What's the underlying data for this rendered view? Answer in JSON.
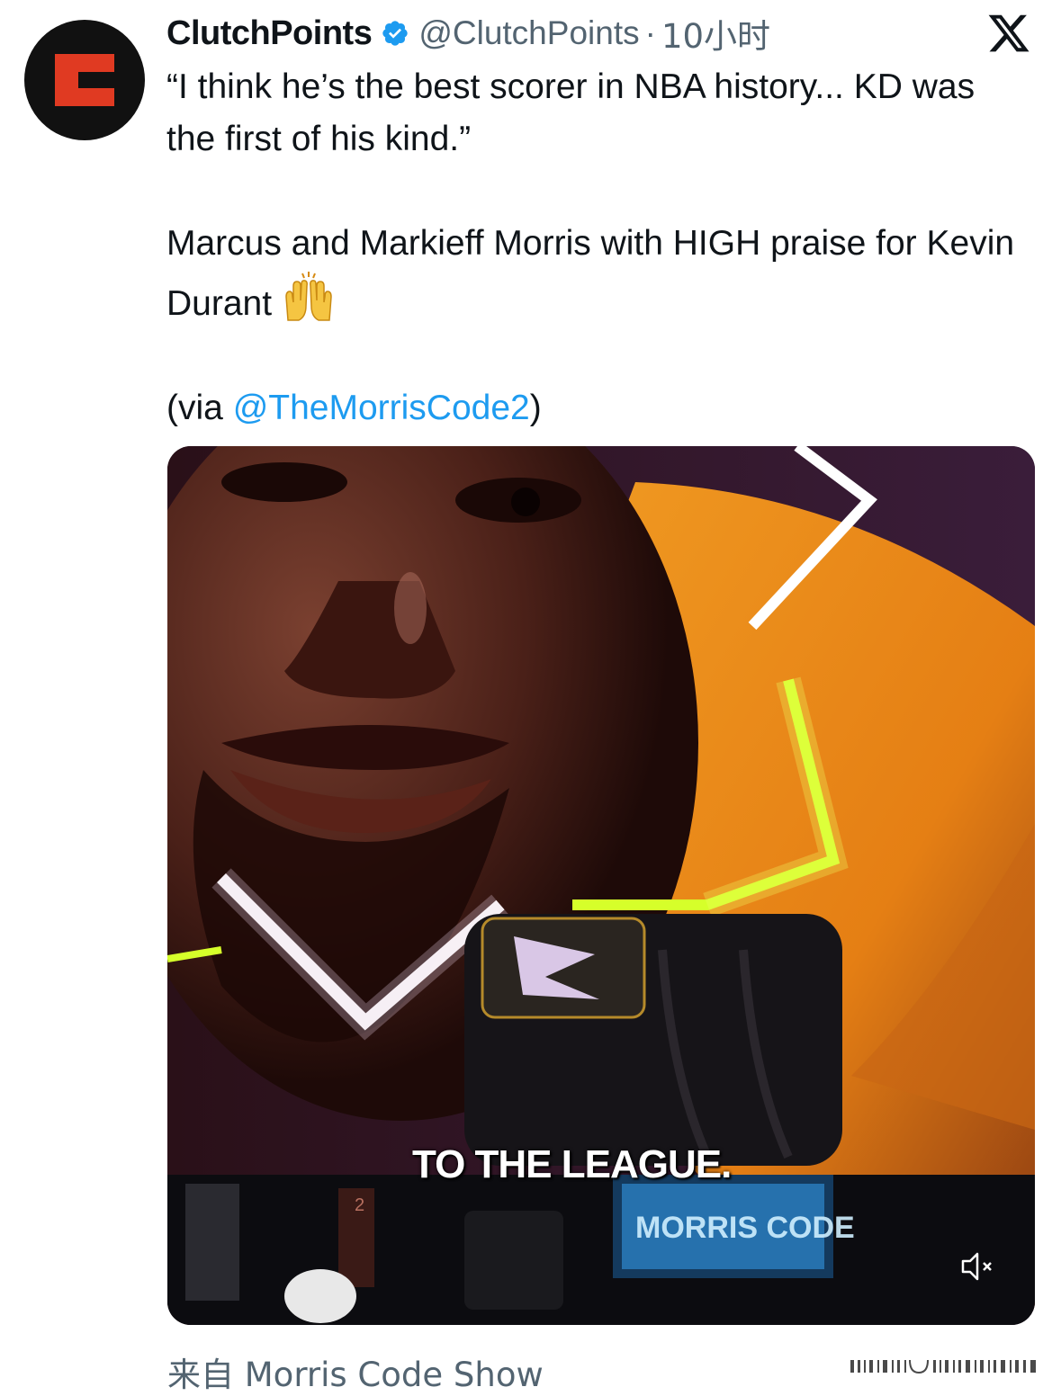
{
  "post": {
    "author_name": "ClutchPoints",
    "author_handle": "@ClutchPoints",
    "separator": "·",
    "time": "10小时",
    "avatar_letter": "C",
    "verified_color": "#1d9bf0",
    "line1": "“I think he’s the best scorer in NBA history... KD was the first of his kind.”",
    "line2": "Marcus and Markieff Morris with HIGH praise for Kevin Durant",
    "emoji_name": "raising-hands-emoji",
    "via_prefix": "(via ",
    "via_mention": "@TheMorrisCode2",
    "via_suffix": ")"
  },
  "media": {
    "caption": "TO THE LEAGUE.",
    "overlay_logo_text": "MORRIS CODE",
    "jersey_number": "2",
    "mute_icon": "speaker-muted-icon"
  },
  "footer": {
    "source_label": "来自 Morris Code Show"
  },
  "colors": {
    "accent_link": "#1d9bf0",
    "text_primary": "#0f1419",
    "text_secondary": "#536471",
    "brand_red": "#e03a22"
  }
}
